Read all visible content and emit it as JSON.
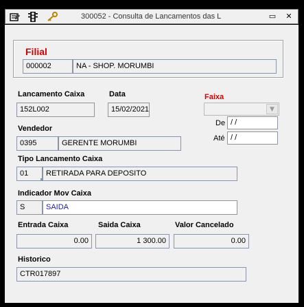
{
  "window": {
    "title": "300052 - Consulta de Lancamentos das L",
    "minimize_glyph": "▭",
    "close_glyph": "✕",
    "icons": [
      "edit-icon",
      "traffic-light-icon",
      "key-icon"
    ]
  },
  "filial": {
    "heading": "Filial",
    "code": "000002",
    "name": "NA - SHOP. MORUMBI"
  },
  "lancamento": {
    "label": "Lancamento Caixa",
    "value": "152L002"
  },
  "data": {
    "label": "Data",
    "value": "15/02/2021"
  },
  "faixa": {
    "label": "Faixa",
    "selected": "",
    "de_label": "De",
    "de_value": " / /",
    "ate_label": "Até",
    "ate_value": " / /"
  },
  "vendedor": {
    "label": "Vendedor",
    "code": "0395",
    "name": "GERENTE MORUMBI"
  },
  "tipo": {
    "label": "Tipo Lancamento Caixa",
    "code": "01",
    "name": "RETIRADA PARA DEPOSITO"
  },
  "indicador": {
    "label": "Indicador Mov Caixa",
    "code": "S",
    "name": "SAIDA"
  },
  "entrada": {
    "label": "Entrada Caixa",
    "value": "0.00"
  },
  "saida": {
    "label": "Saida Caixa",
    "value": "1 300.00"
  },
  "cancelado": {
    "label": "Valor Cancelado",
    "value": "0.00"
  },
  "historico": {
    "label": "Historico",
    "value": "CTR017897"
  },
  "colors": {
    "accent_red": "#d40000",
    "field_border": "#8a94a6",
    "link_blue": "#1a1ac8"
  }
}
